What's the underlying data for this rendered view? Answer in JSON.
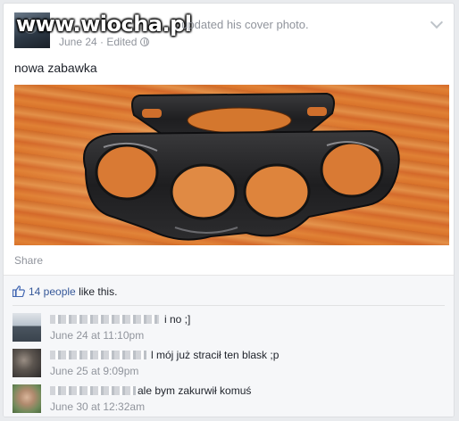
{
  "watermark": "www.wiocha.pl",
  "post": {
    "action": ", updated his cover photo.",
    "date": "June 24",
    "separator": " · ",
    "edited": "Edited",
    "text": "nowa zabawka",
    "share": "Share"
  },
  "likes": {
    "count": "14 people",
    "suffix": "like this."
  },
  "comments": [
    {
      "text": "i no ;]",
      "time": "June 24 at 11:10pm"
    },
    {
      "text": "l mój już stracił ten blask ;p",
      "time": "June 25 at 9:09pm"
    },
    {
      "text": "ale bym zakurwił komuś",
      "time": "June 30 at 12:32am"
    }
  ],
  "colors": {
    "link": "#365899",
    "meta": "#90949c",
    "background": "#e9ebee"
  },
  "icons": {
    "privacy": "globe-icon",
    "menu": "chevron-down-icon",
    "like": "thumbs-up-icon"
  }
}
